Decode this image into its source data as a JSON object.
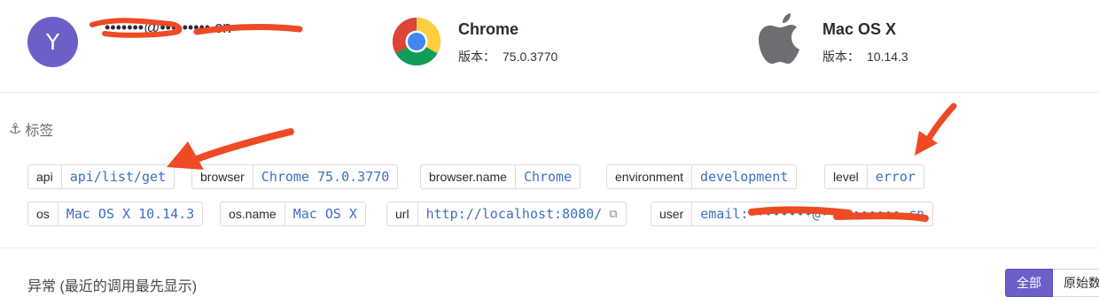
{
  "user": {
    "avatar_letter": "Y",
    "email": "•••••••@•••••••••.cn"
  },
  "browser": {
    "name": "Chrome",
    "version_label": "版本：",
    "version": "75.0.3770"
  },
  "os": {
    "name": "Mac OS X",
    "version_label": "版本：",
    "version": "10.14.3"
  },
  "tags_section": {
    "heading": "标签",
    "tags": [
      {
        "key": "api",
        "value": "api/list/get"
      },
      {
        "key": "browser",
        "value": "Chrome 75.0.3770"
      },
      {
        "key": "browser.name",
        "value": "Chrome"
      },
      {
        "key": "environment",
        "value": "development"
      },
      {
        "key": "level",
        "value": "error"
      },
      {
        "key": "os",
        "value": "Mac OS X 10.14.3"
      },
      {
        "key": "os.name",
        "value": "Mac OS X"
      },
      {
        "key": "url",
        "value": "http://localhost:8080/"
      },
      {
        "key": "user",
        "value": "email:••••••••@••••••••••.cn"
      }
    ]
  },
  "exceptions": {
    "heading": "异常 (最近的调用最先显示)",
    "buttons": {
      "all": "全部",
      "raw": "原始数"
    }
  },
  "colors": {
    "accent": "#6c5fc7",
    "tag_value": "#3b6fc4",
    "annotation_arrow": "#ee4a24"
  },
  "icons": {
    "browser": "chrome-logo-icon",
    "os": "apple-logo-icon",
    "tags": "anchor-icon",
    "external": "external-link-icon"
  }
}
